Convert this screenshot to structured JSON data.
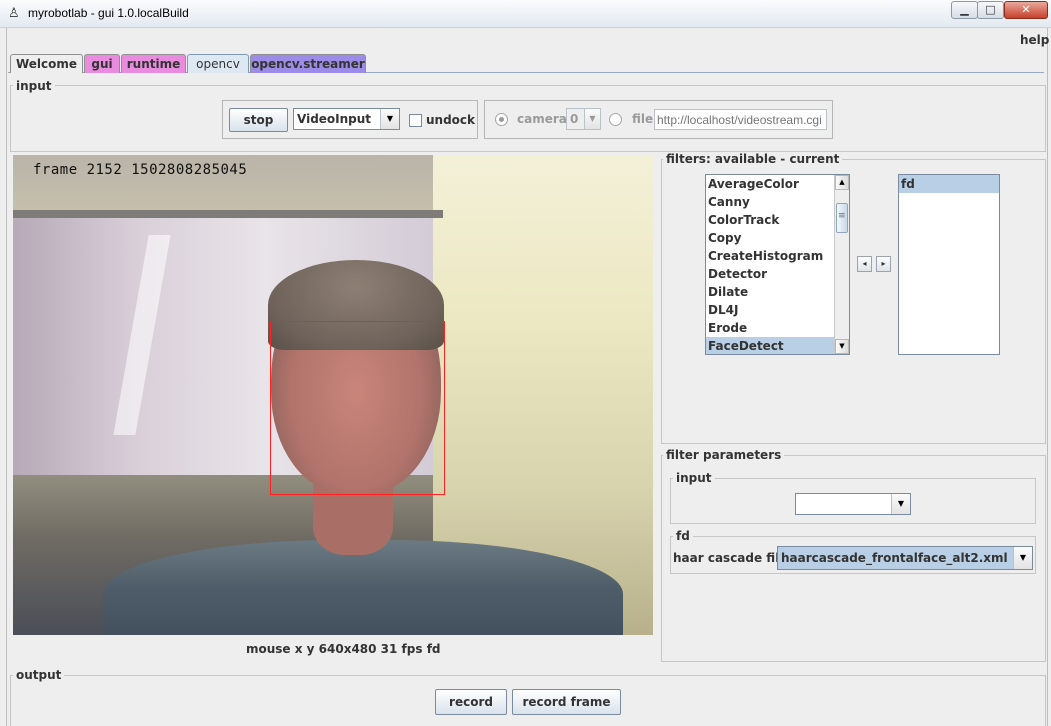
{
  "window": {
    "title": "myrobotlab - gui 1.0.localBuild",
    "minimize_glyph": "▁",
    "maximize_glyph": "□",
    "close_glyph": "✕",
    "icon": "robot-icon"
  },
  "menu": {
    "help_label": "help"
  },
  "tabs": [
    {
      "label": "Welcome",
      "color": "#eeeeee"
    },
    {
      "label": "gui",
      "color": "#e98ce0"
    },
    {
      "label": "runtime",
      "color": "#e98ce0"
    },
    {
      "label": "opencv",
      "color": "#dde8f3",
      "active": true
    },
    {
      "label": "opencv.streamer",
      "color": "#9d8be8"
    }
  ],
  "input_panel": {
    "title": "input",
    "stop_label": "stop",
    "source_selected": "VideoInput",
    "undock_label": "undock",
    "undock_checked": false,
    "camera_label": "camera",
    "camera_selected": true,
    "camera_index": "0",
    "file_label": "file",
    "file_selected": false,
    "file_url_placeholder": "http://localhost/videostream.cgi"
  },
  "video": {
    "overlay_text": "frame 2152 1502808285045",
    "status_text": "mouse x y  640x480  31 fps  fd",
    "face_box_color": "#ff2020"
  },
  "filters": {
    "title": "filters: available - current",
    "available": [
      "AverageColor",
      "Canny",
      "ColorTrack",
      "Copy",
      "CreateHistogram",
      "Detector",
      "Dilate",
      "DL4J",
      "Erode",
      "FaceDetect"
    ],
    "available_selected": "FaceDetect",
    "current": [
      "fd"
    ],
    "current_selected": "fd",
    "move_left_glyph": "◂",
    "move_right_glyph": "▸"
  },
  "filter_parameters": {
    "title": "filter parameters",
    "input_title": "input",
    "input_selected": "",
    "fd_title": "fd",
    "haar_label": "haar cascade file",
    "haar_selected": "haarcascade_frontalface_alt2.xml"
  },
  "output_panel": {
    "title": "output",
    "record_label": "record",
    "record_frame_label": "record frame"
  },
  "glyphs": {
    "combo_arrow": "▼",
    "scroll_up": "▲",
    "scroll_down": "▼",
    "grip": "≡"
  }
}
